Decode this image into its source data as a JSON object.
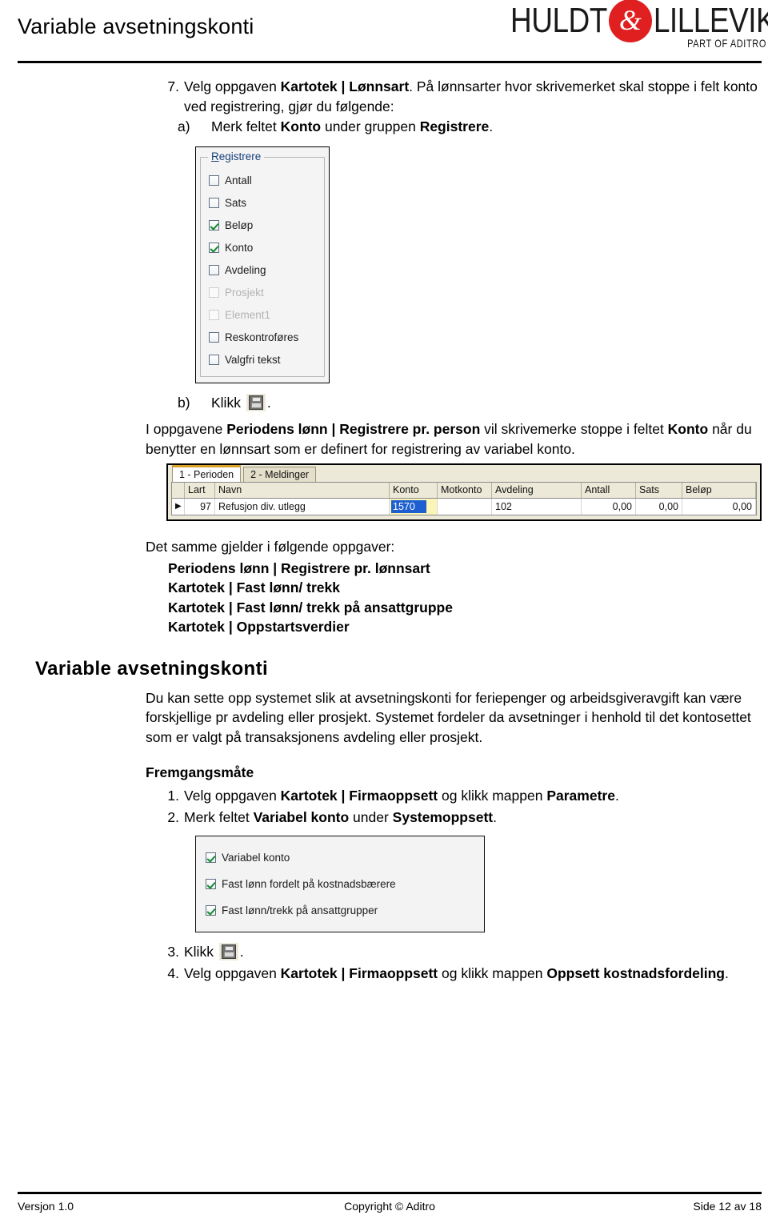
{
  "header": {
    "title": "Variable avsetningskonti",
    "logo": {
      "left": "HULDT",
      "amp": "&",
      "right": "LILLEVIK",
      "tagline": "PART OF ADITRO"
    }
  },
  "step7": {
    "number": "7.",
    "line1_a": "Velg oppgaven ",
    "line1_b": "Kartotek | Lønnsart",
    "line1_c": ". På lønnsarter hvor skrivemerket skal stoppe i felt konto ved registrering, gjør du følgende:",
    "sub_a": {
      "marker": "a)",
      "text_a": "Merk feltet ",
      "text_b": "Konto",
      "text_c": " under gruppen ",
      "text_d": "Registrere",
      "text_e": "."
    },
    "sub_b": {
      "marker": "b)",
      "text": "Klikk",
      "icon": "save-icon",
      "period": "."
    }
  },
  "registrere_group": {
    "title_accel": "R",
    "title_rest": "egistrere",
    "items": [
      {
        "label": "Antall",
        "checked": false,
        "disabled": false
      },
      {
        "label": "Sats",
        "checked": false,
        "disabled": false
      },
      {
        "label": "Beløp",
        "checked": true,
        "disabled": false
      },
      {
        "label": "Konto",
        "checked": true,
        "disabled": false
      },
      {
        "label": "Avdeling",
        "checked": false,
        "disabled": false
      },
      {
        "label": "Prosjekt",
        "checked": false,
        "disabled": true
      },
      {
        "label": "Element1",
        "checked": false,
        "disabled": true
      },
      {
        "label": "Reskontroføres",
        "checked": false,
        "disabled": false
      },
      {
        "label": "Valgfri tekst",
        "checked": false,
        "disabled": false
      }
    ]
  },
  "para_oppgavene": {
    "a": "I oppgavene ",
    "b": "Periodens lønn | Registrere pr. person",
    "c": " vil skrivemerke stoppe i feltet ",
    "d": "Konto",
    "e": " når du benytter en lønnsart som er definert for registrering av variabel konto."
  },
  "grid": {
    "tabs": [
      {
        "label": "1 - Perioden",
        "active": true
      },
      {
        "label": "2 - Meldinger",
        "active": false
      }
    ],
    "columns": [
      "Lart",
      "Navn",
      "Konto",
      "Motkonto",
      "Avdeling",
      "Antall",
      "Sats",
      "Beløp"
    ],
    "row": {
      "marker": "▶",
      "lart": "97",
      "navn": "Refusjon div. utlegg",
      "konto": "1570",
      "motkonto": "",
      "avdeling": "102",
      "antall": "0,00",
      "sats": "0,00",
      "belop": "0,00"
    },
    "colors": {
      "selection": "#1d5fd0",
      "active_cell": "#fbf5ba",
      "tab_accent": "#d9a22b"
    }
  },
  "det_samme": {
    "intro": "Det samme gjelder i følgende oppgaver:",
    "items": [
      "Periodens lønn | Registrere pr. lønnsart",
      "Kartotek | Fast lønn/ trekk",
      "Kartotek | Fast lønn/ trekk på ansattgruppe",
      "Kartotek | Oppstartsverdier"
    ]
  },
  "section": {
    "heading": "Variable avsetningskonti",
    "body": "Du kan sette opp systemet slik at avsetningskonti for feriepenger og arbeidsgiveravgift kan være forskjellige pr avdeling eller prosjekt. Systemet fordeler da avsetninger i henhold til det kontosettet som er valgt på transaksjonens avdeling eller prosjekt."
  },
  "fremgangsmate": {
    "heading": "Fremgangsmåte",
    "step1": {
      "number": "1.",
      "a": "Velg oppgaven ",
      "b": "Kartotek | Firmaoppsett",
      "c": " og klikk mappen ",
      "d": "Parametre",
      "e": "."
    },
    "step2": {
      "number": "2.",
      "a": "Merk feltet ",
      "b": "Variabel konto",
      "c": " under ",
      "d": "Systemoppsett",
      "e": "."
    },
    "step3": {
      "number": "3.",
      "a": "Klikk",
      "icon": "save-icon",
      "period": "."
    },
    "step4": {
      "number": "4.",
      "a": "Velg oppgaven ",
      "b": "Kartotek | Firmaoppsett",
      "c": " og klikk mappen ",
      "d": "Oppsett kostnadsfordeling",
      "e": "."
    }
  },
  "systemoppsett_group": {
    "items": [
      {
        "label": "Variabel konto",
        "checked": true
      },
      {
        "label": "Fast lønn fordelt på kostnadsbærere",
        "checked": true
      },
      {
        "label": "Fast lønn/trekk på ansattgrupper",
        "checked": true
      }
    ]
  },
  "footer": {
    "left": "Versjon 1.0",
    "center": "Copyright © Aditro",
    "right": "Side 12 av 18"
  }
}
